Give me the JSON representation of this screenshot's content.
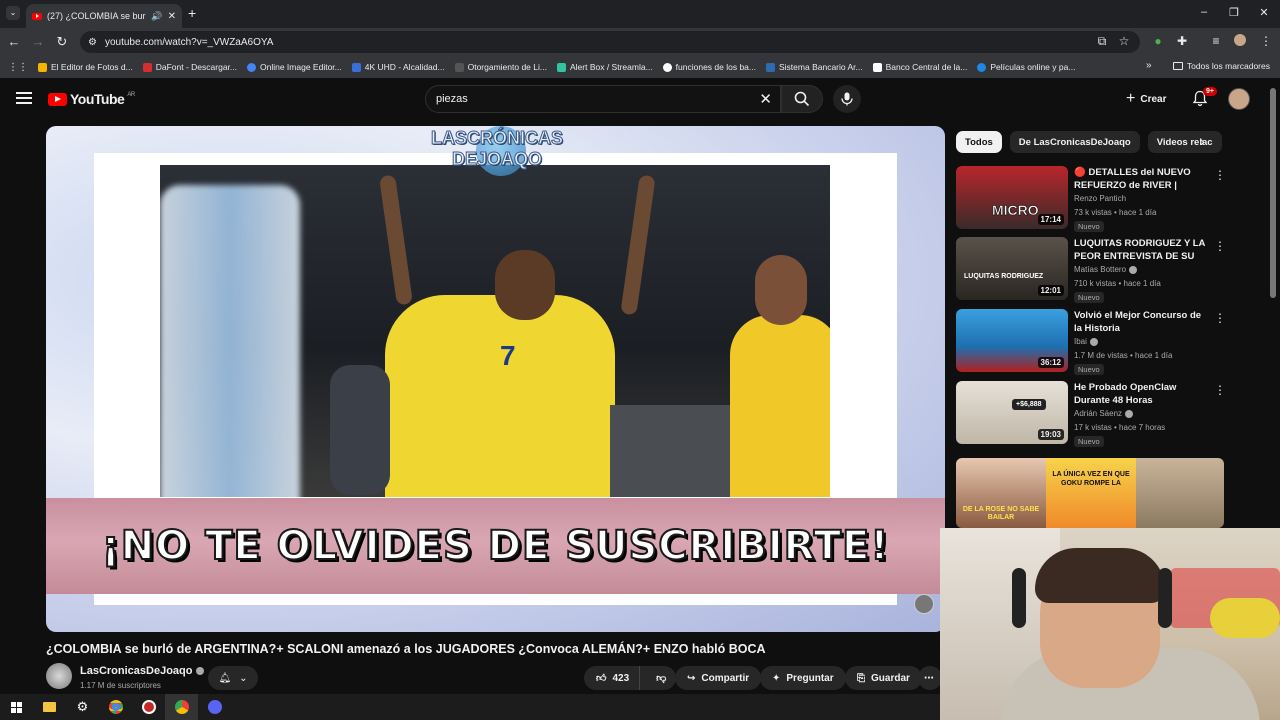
{
  "browser": {
    "tab_title": "(27) ¿COLOMBIA se burló d",
    "url": "youtube.com/watch?v=_VWZaA6OYA",
    "bookmarks": [
      {
        "label": "El Editor de Fotos d...",
        "color": "#f4b400"
      },
      {
        "label": "DaFont - Descargar...",
        "color": "#d32f2f"
      },
      {
        "label": "Online Image Editor...",
        "color": "#4285f4"
      },
      {
        "label": "4K UHD - Alcalidad...",
        "color": "#3b6fd8"
      },
      {
        "label": "Otorgamiento de Li...",
        "color": "#555555"
      },
      {
        "label": "Alert Box / Streamla...",
        "color": "#31c3a2"
      },
      {
        "label": "funciones de los ba...",
        "color": "#ffffff"
      },
      {
        "label": "Sistema Bancario Ar...",
        "color": "#2b6cb0"
      },
      {
        "label": "Banco Central de la...",
        "color": "#ffffff"
      },
      {
        "label": "Películas online y pa...",
        "color": "#1e88e5"
      }
    ],
    "bookmarks_all": "Todos los marcadores"
  },
  "youtube": {
    "logo_text": "YouTube",
    "country": "AR",
    "search_value": "piezas",
    "create_label": "Crear",
    "notif_count": "9+"
  },
  "player": {
    "watermark_line1": "LASCRÓNICAS",
    "watermark_line2": "DEJOAQO",
    "overlay_text": "¡NO TE OLVIDES DE SUSCRIBIRTE!"
  },
  "video": {
    "title": "¿COLOMBIA se burló de ARGENTINA?+ SCALONI amenazó a los JUGADORES ¿Convoca ALEMÁN?+ ENZO habló BOCA",
    "channel": "LasCronicasDeJoaqo",
    "subscribers": "1.17 M de suscriptores",
    "likes": "423",
    "share_label": "Compartir",
    "ask_label": "Preguntar",
    "save_label": "Guardar"
  },
  "sidebar": {
    "chips": [
      "Todos",
      "De LasCronicasDeJoaqo",
      "Videos relac"
    ],
    "related": [
      {
        "title": "🔴 DETALLES del NUEVO REFUERZO de RIVER | ¡LLEGA ...",
        "channel": "Renzo Pantich",
        "meta": "73 k vistas • hace 1 día",
        "badge": "Nuevo",
        "duration": "17:14",
        "thumb_text": "MICRO",
        "thumb_color": "#b8262b"
      },
      {
        "title": "LUQUITAS RODRIGUEZ Y LA PEOR ENTREVISTA DE SU VID...",
        "channel": "Matías Bottero",
        "meta": "710 k vistas • hace 1 día",
        "badge": "Nuevo",
        "duration": "12:01",
        "thumb_text": "LUQUITAS RODRIGUEZ",
        "thumb_color": "#3a3530"
      },
      {
        "title": "Volvió el Mejor Concurso de la Historia",
        "channel": "Ibai",
        "meta": "1.7 M de vistas • hace 1 día",
        "badge": "Nuevo",
        "duration": "36:12",
        "thumb_text": "",
        "thumb_color": "#2e8fd0"
      },
      {
        "title": "He Probado OpenClaw Durante 48 Horas",
        "channel": "Adrián Sáenz",
        "meta": "17 k vistas • hace 7 horas",
        "badge": "Nuevo",
        "duration": "19:03",
        "thumb_text": "+$6,888",
        "thumb_color": "#d7d2c8"
      }
    ],
    "shorts_texts": [
      "DE LA ROSE NO SABE BAILAR",
      "LA ÚNICA VEZ EN QUE GOKU ROMPE LA"
    ]
  }
}
